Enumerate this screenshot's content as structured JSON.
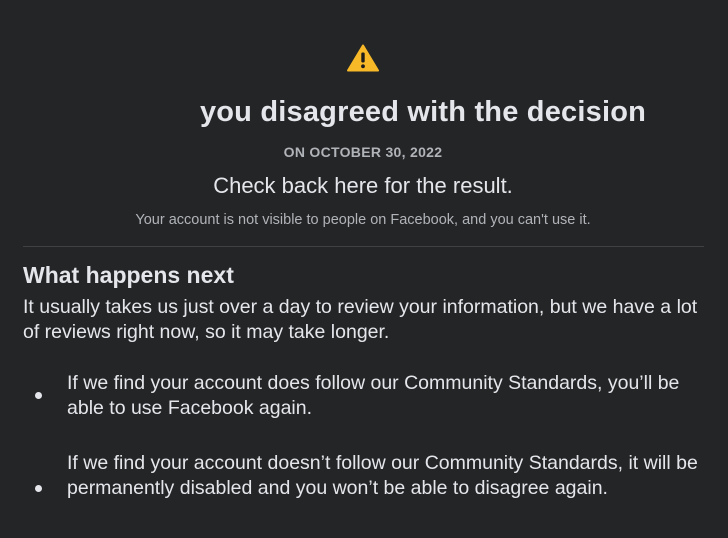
{
  "status": {
    "icon": "warning-icon",
    "headline": "you disagreed with the decision",
    "date": "ON OCTOBER 30, 2022",
    "check_back": "Check back here for the result.",
    "visibility_note": "Your account is not visible to people on Facebook, and you can't use it."
  },
  "next": {
    "title": "What happens next",
    "intro": "It usually takes us just over a day to review your information, but we have a lot of reviews right now, so it may take longer.",
    "items": [
      "If we find your account does follow our Community Standards, you’ll be able to use Facebook again.",
      "If we find your account doesn’t follow our Community Standards, it will be permanently disabled and you won’t be able to disagree again."
    ]
  },
  "colors": {
    "background": "#242526",
    "text_primary": "#e4e6eb",
    "text_secondary": "#b0b3b8",
    "warning": "#f7b928"
  }
}
